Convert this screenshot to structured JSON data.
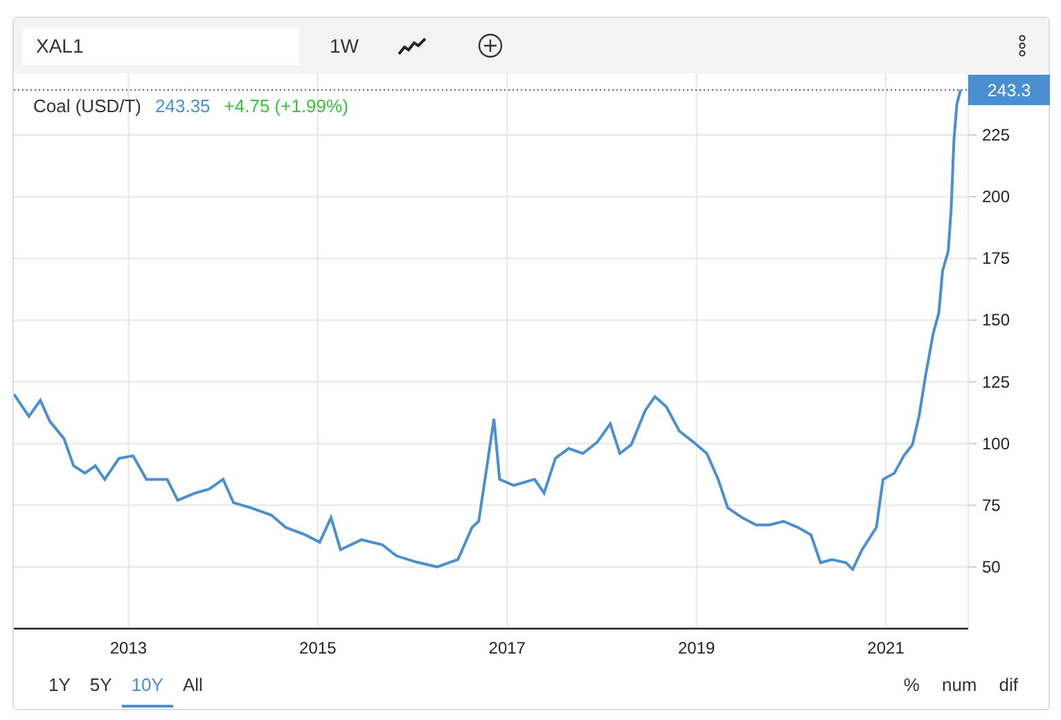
{
  "toolbar": {
    "symbol": "XAL1",
    "interval": "1W"
  },
  "legend": {
    "price": "243.35",
    "change": "+4.75 (+1.99%)"
  },
  "chart_data": {
    "type": "line",
    "x": [
      2011.79,
      2011.95,
      2012.07,
      2012.17,
      2012.32,
      2012.42,
      2012.54,
      2012.65,
      2012.75,
      2012.9,
      2013.05,
      2013.19,
      2013.41,
      2013.52,
      2013.71,
      2013.85,
      2014.0,
      2014.11,
      2014.29,
      2014.51,
      2014.66,
      2014.87,
      2015.02,
      2015.14,
      2015.24,
      2015.46,
      2015.68,
      2015.83,
      2016.04,
      2016.26,
      2016.48,
      2016.63,
      2016.7,
      2016.8,
      2016.86,
      2016.92,
      2017.07,
      2017.29,
      2017.39,
      2017.51,
      2017.65,
      2017.8,
      2017.95,
      2018.09,
      2018.19,
      2018.31,
      2018.46,
      2018.56,
      2018.68,
      2018.82,
      2018.97,
      2019.11,
      2019.23,
      2019.33,
      2019.48,
      2019.63,
      2019.77,
      2019.92,
      2020.07,
      2020.21,
      2020.31,
      2020.43,
      2020.58,
      2020.65,
      2020.75,
      2020.9,
      2020.97,
      2021.09,
      2021.19,
      2021.28,
      2021.35,
      2021.42,
      2021.5,
      2021.56,
      2021.6,
      2021.66,
      2021.69,
      2021.72,
      2021.75,
      2021.79
    ],
    "series": [
      {
        "name": "Coal (USD/T)",
        "color": "#4a8fd0",
        "values": [
          120,
          111,
          117.5,
          109,
          102,
          91,
          88,
          91,
          85.5,
          94,
          95,
          85.5,
          85.5,
          77,
          80,
          81.5,
          85.5,
          76,
          74,
          71,
          66,
          63,
          60,
          70,
          57,
          61,
          59,
          54.5,
          52,
          50,
          53,
          66,
          68.5,
          94,
          110,
          85.5,
          83,
          85.5,
          80,
          94,
          98,
          96,
          100.5,
          108,
          96,
          99.5,
          113.5,
          119,
          115,
          105,
          100.5,
          96,
          85.5,
          74,
          70,
          67,
          67,
          68.5,
          66,
          63,
          51.7,
          53,
          51.7,
          49,
          57,
          66,
          85.5,
          88,
          95,
          99.5,
          111,
          127.5,
          144.5,
          153,
          170,
          178,
          195,
          223,
          237.5,
          243.3
        ]
      }
    ],
    "grid": true,
    "ref_lines": [
      {
        "axis": "y",
        "value": 243.3,
        "label": "243.3",
        "color": "#5555dd"
      }
    ],
    "xlim": [
      2011.79,
      2021.87
    ],
    "ylim": [
      25,
      250
    ],
    "xticks": [
      {
        "value": 2013,
        "label": "2013"
      },
      {
        "value": 2015,
        "label": "2015"
      },
      {
        "value": 2017,
        "label": "2017"
      },
      {
        "value": 2019,
        "label": "2019"
      },
      {
        "value": 2021,
        "label": "2021"
      }
    ],
    "yticks": [
      50,
      75,
      100,
      125,
      150,
      175,
      200,
      225
    ]
  },
  "ranges": [
    {
      "label": "1Y",
      "selected": false
    },
    {
      "label": "5Y",
      "selected": false
    },
    {
      "label": "10Y",
      "selected": true
    },
    {
      "label": "All",
      "selected": false
    }
  ],
  "display_modes": [
    "%",
    "num",
    "dif"
  ]
}
